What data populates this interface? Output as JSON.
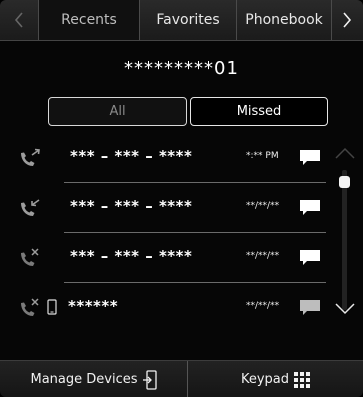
{
  "tabs": {
    "recents": "Recents",
    "favorites": "Favorites",
    "phonebook": "Phonebook",
    "active": "recents"
  },
  "number": "*********01",
  "filter": {
    "all": "All",
    "missed": "Missed",
    "selected": "missed"
  },
  "calls": [
    {
      "name": "*** – *** – ****",
      "time": "*:** PM",
      "type": "outgoing"
    },
    {
      "name": "*** – *** – ****",
      "time": "**/**/**",
      "type": "incoming"
    },
    {
      "name": "*** – *** – ****",
      "time": "**/**/**",
      "type": "missed"
    },
    {
      "name": "******",
      "time": "**/**/**",
      "type": "missed"
    }
  ],
  "bottom": {
    "manage": "Manage Devices",
    "keypad": "Keypad"
  },
  "colors": {
    "background": "#060606",
    "icon_gray": "#9c9c9c",
    "text": "#ffffff"
  }
}
